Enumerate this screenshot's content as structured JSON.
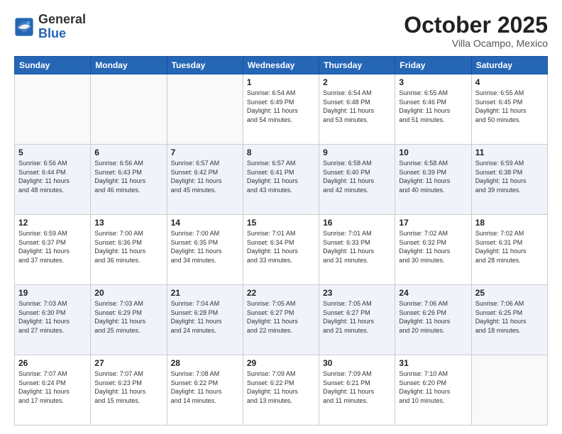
{
  "header": {
    "logo_general": "General",
    "logo_blue": "Blue",
    "month": "October 2025",
    "location": "Villa Ocampo, Mexico"
  },
  "weekdays": [
    "Sunday",
    "Monday",
    "Tuesday",
    "Wednesday",
    "Thursday",
    "Friday",
    "Saturday"
  ],
  "weeks": [
    [
      {
        "day": "",
        "info": ""
      },
      {
        "day": "",
        "info": ""
      },
      {
        "day": "",
        "info": ""
      },
      {
        "day": "1",
        "info": "Sunrise: 6:54 AM\nSunset: 6:49 PM\nDaylight: 11 hours\nand 54 minutes."
      },
      {
        "day": "2",
        "info": "Sunrise: 6:54 AM\nSunset: 6:48 PM\nDaylight: 11 hours\nand 53 minutes."
      },
      {
        "day": "3",
        "info": "Sunrise: 6:55 AM\nSunset: 6:46 PM\nDaylight: 11 hours\nand 51 minutes."
      },
      {
        "day": "4",
        "info": "Sunrise: 6:55 AM\nSunset: 6:45 PM\nDaylight: 11 hours\nand 50 minutes."
      }
    ],
    [
      {
        "day": "5",
        "info": "Sunrise: 6:56 AM\nSunset: 6:44 PM\nDaylight: 11 hours\nand 48 minutes."
      },
      {
        "day": "6",
        "info": "Sunrise: 6:56 AM\nSunset: 6:43 PM\nDaylight: 11 hours\nand 46 minutes."
      },
      {
        "day": "7",
        "info": "Sunrise: 6:57 AM\nSunset: 6:42 PM\nDaylight: 11 hours\nand 45 minutes."
      },
      {
        "day": "8",
        "info": "Sunrise: 6:57 AM\nSunset: 6:41 PM\nDaylight: 11 hours\nand 43 minutes."
      },
      {
        "day": "9",
        "info": "Sunrise: 6:58 AM\nSunset: 6:40 PM\nDaylight: 11 hours\nand 42 minutes."
      },
      {
        "day": "10",
        "info": "Sunrise: 6:58 AM\nSunset: 6:39 PM\nDaylight: 11 hours\nand 40 minutes."
      },
      {
        "day": "11",
        "info": "Sunrise: 6:59 AM\nSunset: 6:38 PM\nDaylight: 11 hours\nand 39 minutes."
      }
    ],
    [
      {
        "day": "12",
        "info": "Sunrise: 6:59 AM\nSunset: 6:37 PM\nDaylight: 11 hours\nand 37 minutes."
      },
      {
        "day": "13",
        "info": "Sunrise: 7:00 AM\nSunset: 6:36 PM\nDaylight: 11 hours\nand 36 minutes."
      },
      {
        "day": "14",
        "info": "Sunrise: 7:00 AM\nSunset: 6:35 PM\nDaylight: 11 hours\nand 34 minutes."
      },
      {
        "day": "15",
        "info": "Sunrise: 7:01 AM\nSunset: 6:34 PM\nDaylight: 11 hours\nand 33 minutes."
      },
      {
        "day": "16",
        "info": "Sunrise: 7:01 AM\nSunset: 6:33 PM\nDaylight: 11 hours\nand 31 minutes."
      },
      {
        "day": "17",
        "info": "Sunrise: 7:02 AM\nSunset: 6:32 PM\nDaylight: 11 hours\nand 30 minutes."
      },
      {
        "day": "18",
        "info": "Sunrise: 7:02 AM\nSunset: 6:31 PM\nDaylight: 11 hours\nand 28 minutes."
      }
    ],
    [
      {
        "day": "19",
        "info": "Sunrise: 7:03 AM\nSunset: 6:30 PM\nDaylight: 11 hours\nand 27 minutes."
      },
      {
        "day": "20",
        "info": "Sunrise: 7:03 AM\nSunset: 6:29 PM\nDaylight: 11 hours\nand 25 minutes."
      },
      {
        "day": "21",
        "info": "Sunrise: 7:04 AM\nSunset: 6:28 PM\nDaylight: 11 hours\nand 24 minutes."
      },
      {
        "day": "22",
        "info": "Sunrise: 7:05 AM\nSunset: 6:27 PM\nDaylight: 11 hours\nand 22 minutes."
      },
      {
        "day": "23",
        "info": "Sunrise: 7:05 AM\nSunset: 6:27 PM\nDaylight: 11 hours\nand 21 minutes."
      },
      {
        "day": "24",
        "info": "Sunrise: 7:06 AM\nSunset: 6:26 PM\nDaylight: 11 hours\nand 20 minutes."
      },
      {
        "day": "25",
        "info": "Sunrise: 7:06 AM\nSunset: 6:25 PM\nDaylight: 11 hours\nand 18 minutes."
      }
    ],
    [
      {
        "day": "26",
        "info": "Sunrise: 7:07 AM\nSunset: 6:24 PM\nDaylight: 11 hours\nand 17 minutes."
      },
      {
        "day": "27",
        "info": "Sunrise: 7:07 AM\nSunset: 6:23 PM\nDaylight: 11 hours\nand 15 minutes."
      },
      {
        "day": "28",
        "info": "Sunrise: 7:08 AM\nSunset: 6:22 PM\nDaylight: 11 hours\nand 14 minutes."
      },
      {
        "day": "29",
        "info": "Sunrise: 7:09 AM\nSunset: 6:22 PM\nDaylight: 11 hours\nand 13 minutes."
      },
      {
        "day": "30",
        "info": "Sunrise: 7:09 AM\nSunset: 6:21 PM\nDaylight: 11 hours\nand 11 minutes."
      },
      {
        "day": "31",
        "info": "Sunrise: 7:10 AM\nSunset: 6:20 PM\nDaylight: 11 hours\nand 10 minutes."
      },
      {
        "day": "",
        "info": ""
      }
    ]
  ]
}
